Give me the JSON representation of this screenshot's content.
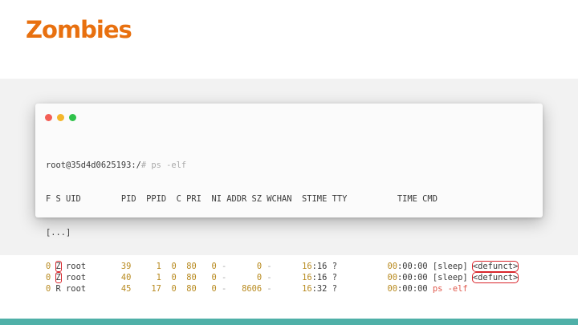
{
  "slide": {
    "title": "Zombies"
  },
  "terminal": {
    "prompt_user": "root@35d4d0625193:/",
    "prompt_cmd": "# ps -elf",
    "header": "F S UID        PID  PPID  C PRI  NI ADDR SZ WCHAN  STIME TTY          TIME CMD",
    "ellipsis": "[...]",
    "rows": [
      {
        "f": "0",
        "s": "Z",
        "uid": "root",
        "pid": "39",
        "ppid": "1",
        "c": "0",
        "pri": "80",
        "ni": "0",
        "addr": "-",
        "sz": "0",
        "wchan": "-",
        "stime_h": "16",
        "stime_m": ":16",
        "tty": "?",
        "time_h": "00",
        "time_r": ":00:00",
        "cmd_main": "[sleep]",
        "cmd_extra": "<defunct>"
      },
      {
        "f": "0",
        "s": "Z",
        "uid": "root",
        "pid": "40",
        "ppid": "1",
        "c": "0",
        "pri": "80",
        "ni": "0",
        "addr": "-",
        "sz": "0",
        "wchan": "-",
        "stime_h": "16",
        "stime_m": ":16",
        "tty": "?",
        "time_h": "00",
        "time_r": ":00:00",
        "cmd_main": "[sleep]",
        "cmd_extra": "<defunct>"
      },
      {
        "f": "0",
        "s": "R",
        "uid": "root",
        "pid": "45",
        "ppid": "17",
        "c": "0",
        "pri": "80",
        "ni": "0",
        "addr": "-",
        "sz": "8606",
        "wchan": "-",
        "stime_h": "16",
        "stime_m": ":32",
        "tty": "?",
        "time_h": "00",
        "time_r": ":00:00",
        "cmd_main": "ps -elf",
        "cmd_extra": ""
      }
    ]
  },
  "colors": {
    "title": "#e8700f",
    "highlight_box": "#d9262c",
    "bottom_bar": "#4fb0a8",
    "number": "#b88a1f",
    "command": "#e05a4e"
  }
}
